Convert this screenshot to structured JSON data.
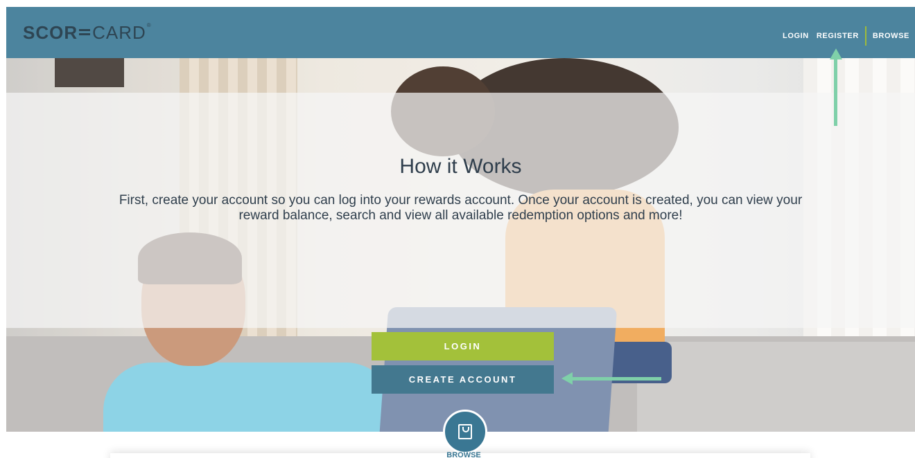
{
  "header": {
    "logo": {
      "part1": "SCOR",
      "part2": "CARD",
      "tm": "®"
    },
    "nav": {
      "login": "LOGIN",
      "register": "REGISTER",
      "browse": "BROWSE"
    }
  },
  "hero": {
    "title": "How it Works",
    "description": "First, create your account so you can log into your rewards account. Once your account is created, you can view your reward balance, search and view all available redemption options and more!",
    "login_button": "LOGIN",
    "create_account_button": "CREATE ACCOUNT"
  },
  "browse": {
    "label": "BROWSE",
    "icon": "shopping-bag-icon"
  },
  "colors": {
    "header": "#4c849e",
    "login_button": "#a3c13a",
    "create_button": "#43788f",
    "annotation_arrow": "#7fd0a9"
  }
}
